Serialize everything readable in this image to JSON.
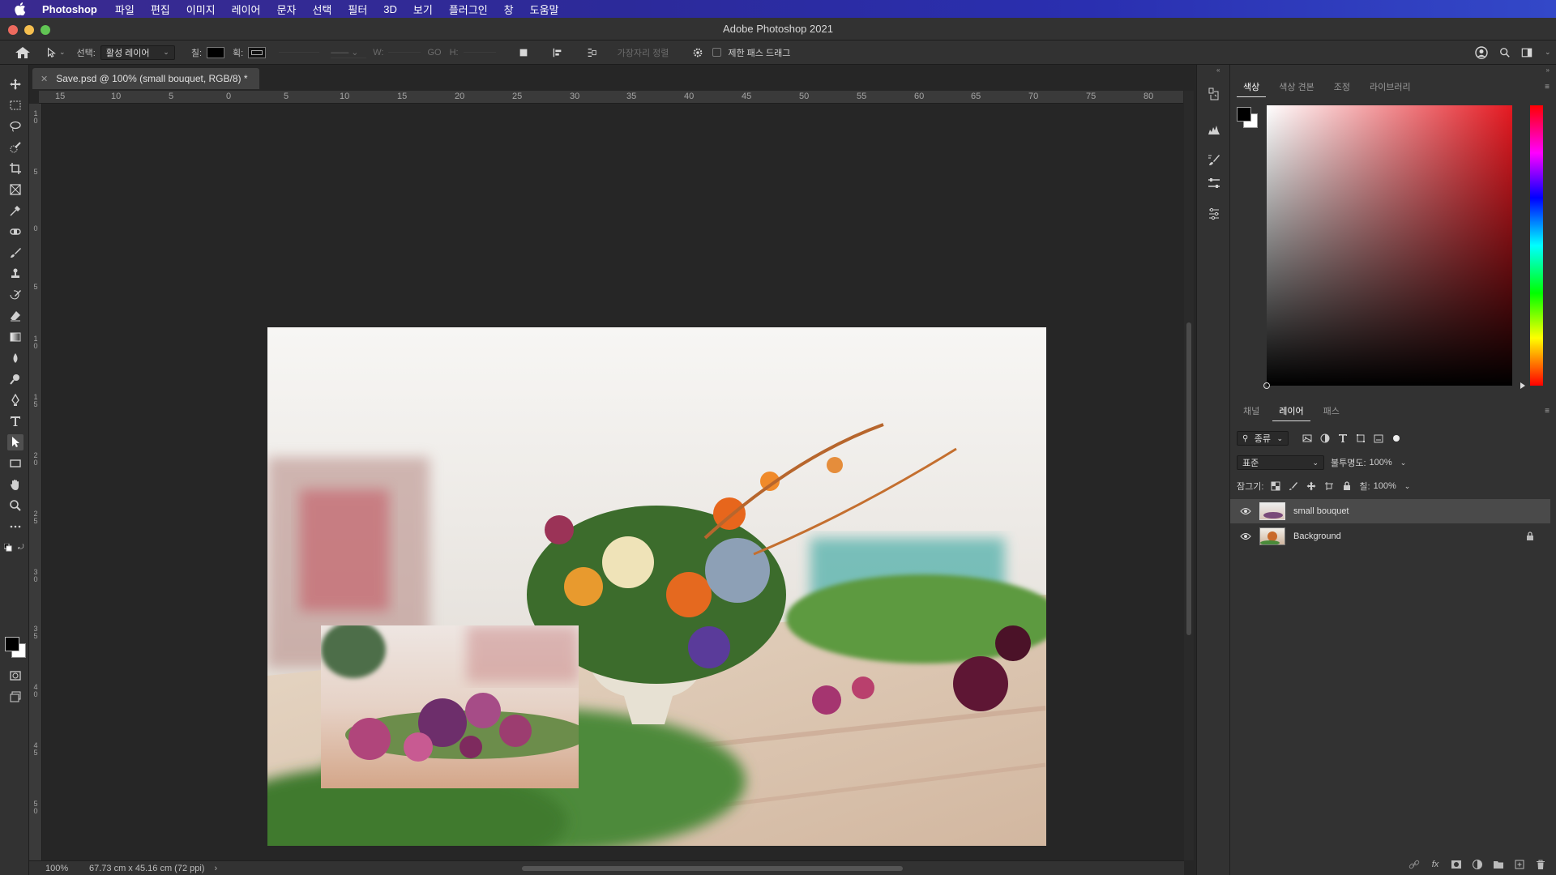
{
  "menubar": {
    "app_name": "Photoshop",
    "items": [
      "파일",
      "편집",
      "이미지",
      "레이어",
      "문자",
      "선택",
      "필터",
      "3D",
      "보기",
      "플러그인",
      "창",
      "도움말"
    ]
  },
  "window": {
    "title": "Adobe Photoshop 2021"
  },
  "options": {
    "select_label": "선택:",
    "select_value": "활성 레이어",
    "fill_label": "칠:",
    "stroke_label": "획:",
    "w_label": "W:",
    "go_label": "GO",
    "h_label": "H:",
    "align_edges": "가장자리 정렬",
    "constrain_path": "제한 패스 드래그"
  },
  "document": {
    "tab_title": "Save.psd @ 100% (small bouquet, RGB/8) *",
    "zoom": "100%",
    "doc_info": "67.73 cm x 45.16 cm (72 ppi)"
  },
  "ruler": {
    "top_ticks": [
      "15",
      "10",
      "5",
      "0",
      "5",
      "10",
      "15",
      "20",
      "25",
      "30",
      "35",
      "40",
      "45",
      "50",
      "55",
      "60",
      "65",
      "70",
      "75",
      "80"
    ],
    "left_ticks": [
      "1\n0",
      "5",
      "0",
      "5",
      "1\n0",
      "1\n5",
      "2\n0",
      "2\n5",
      "3\n0",
      "3\n5",
      "4\n0",
      "4\n5",
      "5\n0"
    ]
  },
  "color_panel": {
    "tabs": [
      "색상",
      "색상 견본",
      "조정",
      "라이브러리"
    ],
    "active_tab": 0,
    "foreground": "#000000",
    "background": "#ffffff",
    "hue_color": "#e51921"
  },
  "layers_panel": {
    "tabs": [
      "채널",
      "레이어",
      "패스"
    ],
    "active_tab": 1,
    "filter_label": "종류",
    "blend_mode": "표준",
    "opacity_label": "불투명도:",
    "opacity_value": "100%",
    "lock_label": "잠그기:",
    "fill_label": "칠:",
    "fill_value": "100%",
    "layers": [
      {
        "name": "small bouquet",
        "selected": true,
        "locked": false
      },
      {
        "name": "Background",
        "selected": false,
        "locked": true
      }
    ],
    "bottom_icons": [
      "link-icon",
      "fx-icon",
      "mask-icon",
      "adjustment-icon",
      "group-icon",
      "new-layer-icon",
      "trash-icon"
    ]
  },
  "colors": {
    "accent_menubar": "#2c2a9a",
    "panel_bg": "#323232",
    "canvas_bg": "#262626"
  }
}
